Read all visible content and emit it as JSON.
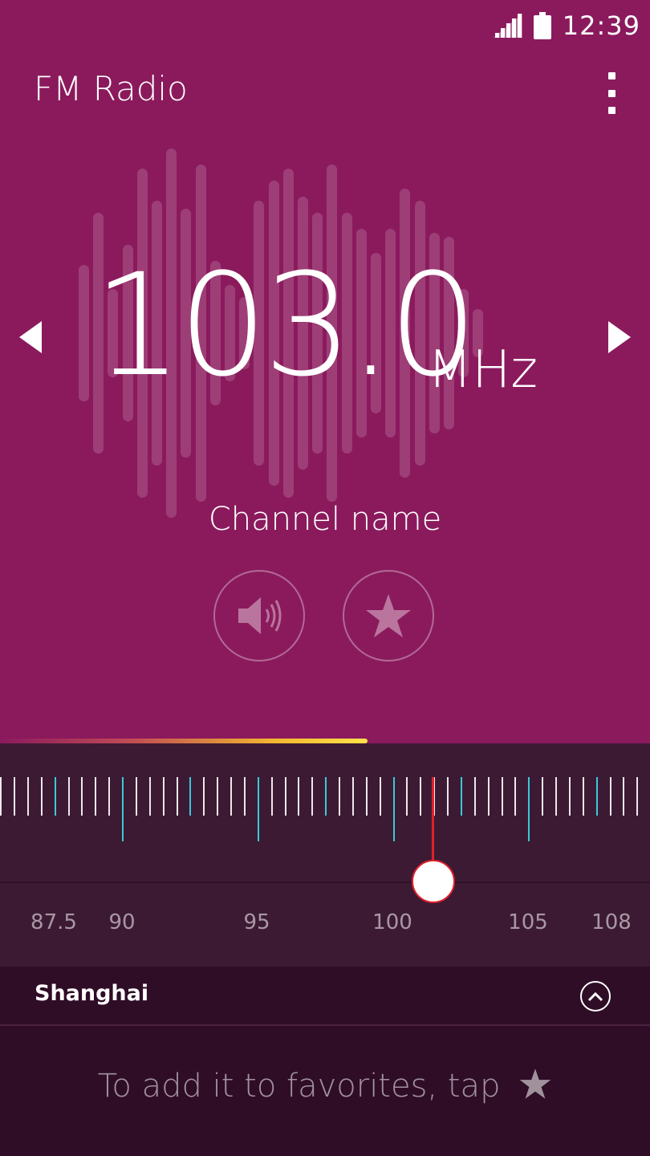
{
  "status_bar": {
    "time": "12:39",
    "signal_icon": "signal-bars-icon",
    "battery_icon": "battery-icon"
  },
  "app_bar": {
    "title": "FM Radio",
    "menu_icon": "more-vertical-icon"
  },
  "tuner_display": {
    "frequency": "103.0",
    "unit": "MHz",
    "channel_name": "Channel name",
    "prev_icon": "arrow-left-icon",
    "next_icon": "arrow-right-icon"
  },
  "controls": {
    "speaker_icon": "speaker-icon",
    "favorite_icon": "star-icon"
  },
  "scale": {
    "min": 87.5,
    "max": 108,
    "current": 103.0,
    "labels": [
      "87.5",
      "90",
      "95",
      "100",
      "105",
      "108"
    ]
  },
  "location": {
    "name": "Shanghai",
    "expand_icon": "chevron-up-icon"
  },
  "favorites": {
    "hint": "To add it to favorites, tap",
    "hint_icon": "star-icon"
  },
  "colors": {
    "background": "#8b1a5d",
    "tuner_bg": "#3d1a34",
    "footer_bg": "#2f0d26",
    "accent_tick": "#39c9d6",
    "needle": "#e0202a"
  }
}
